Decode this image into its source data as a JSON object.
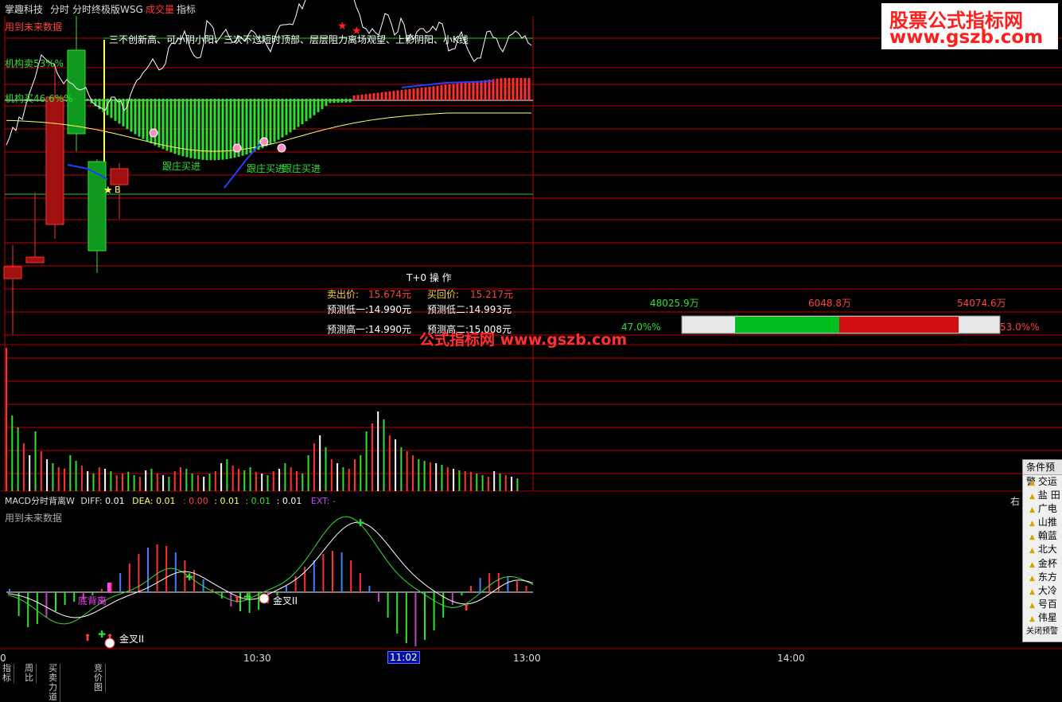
{
  "topbar": {
    "items": [
      "掌趣科技",
      "分时",
      "分时终极版WSG",
      "成交量",
      "指标"
    ],
    "colors": [
      "#dddddd",
      "#dddddd",
      "#dddddd",
      "#ff3b3b",
      "#dddddd"
    ]
  },
  "watermark": {
    "line1": "股票公式指标网",
    "line2": "www.gszb.com",
    "center": "公式指标网  www.gszb.com"
  },
  "upper_panel": {
    "future_label": "用到未来数据",
    "left_labels": [
      "机构卖53%%",
      "机构买46.6%%"
    ],
    "headline": "三不创新高、可小阴小阳、三次不过短时顶部、层层阻力离场观望、上影阴阳、小K线",
    "signals": [
      "跟庄买进",
      "跟庄买进",
      "跟庄买进"
    ],
    "star_label": "B"
  },
  "t0": {
    "title": "T+0  操 作",
    "sell_label": "卖出价:",
    "sell_value": "15.674元",
    "buyback_label": "买回价:",
    "buyback_value": "15.217元",
    "low1": "预测低一:14.990元",
    "low2": "预测低二:14.993元",
    "high1": "预测高一:14.990元",
    "high2": "预测高二:15.008元"
  },
  "flow": {
    "total": "48025.9万",
    "mid": "6048.8万",
    "right": "54074.6万",
    "left_pct": "47.0%%",
    "right_pct": "53.0%%",
    "left_frac": 0.47
  },
  "macd": {
    "name": "MACD分时背离W",
    "diff_label": "DIFF:",
    "diff": "0.01",
    "dea_label": "DEA:",
    "dea": "0.01",
    "v3": "0.00",
    "v4": "0.01",
    "v5": "0.01",
    "v6": "0.01",
    "ext_label": "EXT:",
    "ext": "-",
    "future_label": "用到未来数据",
    "right_cut": "右",
    "annot_low": "底背离",
    "annot_gold": [
      "金叉II",
      "金叉II"
    ]
  },
  "time_axis": {
    "labels": [
      "0",
      "10:30",
      "11:02",
      "13:00",
      "14:00"
    ],
    "highlight": "11:02"
  },
  "cond_panel": {
    "title": "条件预警",
    "items": [
      "交运",
      "盐 田",
      "广电",
      "山推",
      "翰蓝",
      "北大",
      "金杯",
      "东方",
      "大冷",
      "号百",
      "伟星"
    ],
    "footer": "关闭预警"
  },
  "tabs": [
    "指标",
    "周比",
    "买卖力道",
    "竞价图"
  ],
  "colors": {
    "up": "#ff3030",
    "down": "#30e030",
    "grid": "#c00000",
    "white": "#ffffff",
    "yellow": "#ffff60",
    "blue": "#2040ff",
    "magenta": "#ff40ff"
  },
  "chart_data": [
    {
      "type": "line",
      "name": "intraday-price",
      "series": [
        {
          "name": "price",
          "values": [
            128,
            137,
            150,
            146,
            163,
            160,
            176,
            190,
            201,
            212,
            227,
            241,
            237,
            233,
            231,
            230,
            218,
            211,
            205,
            210,
            206,
            204,
            199,
            197,
            198,
            200,
            190,
            182,
            178,
            176,
            174,
            171,
            180,
            188,
            188,
            182,
            183,
            171,
            176,
            191,
            201,
            209,
            212,
            219,
            223,
            229,
            236,
            229,
            222,
            224,
            230,
            250,
            256,
            255,
            262,
            260,
            271,
            259,
            247,
            240,
            237,
            238,
            255,
            284,
            280,
            275,
            257,
            262,
            268,
            273,
            264,
            257,
            257,
            265,
            262,
            258,
            266,
            272,
            269,
            263,
            257,
            260,
            252,
            245,
            257,
            270,
            278,
            279,
            279,
            280,
            279,
            290,
            305,
            299,
            310,
            319,
            346,
            356,
            345,
            334,
            340,
            338,
            357,
            353,
            337,
            331,
            321,
            318,
            316,
            314,
            301,
            292,
            276,
            274,
            268,
            274,
            269,
            266,
            279,
            293,
            291,
            280,
            266,
            270,
            287,
            279,
            259,
            267,
            260,
            270,
            274,
            274,
            269,
            271,
            277,
            272,
            282,
            280,
            264,
            246,
            248,
            249,
            262,
            270,
            258,
            248,
            240,
            233,
            237,
            237,
            254,
            270,
            271,
            263,
            262,
            251,
            245,
            254,
            265,
            267,
            271,
            268,
            262,
            265,
            256,
            253
          ]
        }
      ]
    },
    {
      "type": "bar",
      "name": "macd-histogram",
      "series": [
        {
          "name": "macd",
          "values": [
            0.0002,
            -0.0015,
            -0.0022,
            -0.002,
            -0.0016,
            -0.0012,
            -0.0008,
            -0.0006,
            -0.0004,
            -0.0002,
            0.0002,
            0.0006,
            0.0012,
            0.0018,
            0.0024,
            0.0028,
            0.003,
            0.0029,
            0.0025,
            0.002,
            0.0014,
            0.0008,
            0.0002,
            -0.0004,
            -0.0009,
            -0.0012,
            -0.0013,
            -0.0011,
            -0.0007,
            -0.0002,
            0.0004,
            0.001,
            0.0016,
            0.002,
            0.0024,
            0.0026,
            0.0025,
            0.002,
            0.0012,
            0.0004,
            -0.0006,
            -0.0016,
            -0.0026,
            -0.0032,
            -0.0034,
            -0.003,
            -0.0024,
            -0.0016,
            -0.0008,
            -0.0002,
            0.0004,
            0.0009,
            0.0012,
            0.0012,
            0.001,
            0.0007,
            0.0004
          ]
        }
      ]
    },
    {
      "type": "bar",
      "name": "volume",
      "series": [
        {
          "name": "volume",
          "values": [
            180,
            95,
            80,
            60,
            45,
            75,
            50,
            40,
            35,
            30,
            28,
            45,
            38,
            32,
            25,
            22,
            30,
            28,
            25,
            20,
            22,
            24,
            20,
            18,
            26,
            28,
            22,
            20,
            18,
            25,
            30,
            28,
            22,
            20,
            18,
            22,
            25,
            35,
            40,
            32,
            28,
            26,
            30,
            24,
            22,
            20,
            25,
            28,
            35,
            30,
            25,
            22,
            45,
            60,
            70,
            55,
            40,
            35,
            30,
            28,
            40,
            45,
            75,
            85,
            100,
            90,
            70,
            65,
            55,
            50,
            45,
            40,
            38,
            36,
            35,
            33,
            30,
            28,
            26,
            25,
            24,
            22,
            20,
            18,
            25,
            22,
            20,
            18,
            16
          ]
        }
      ]
    }
  ]
}
